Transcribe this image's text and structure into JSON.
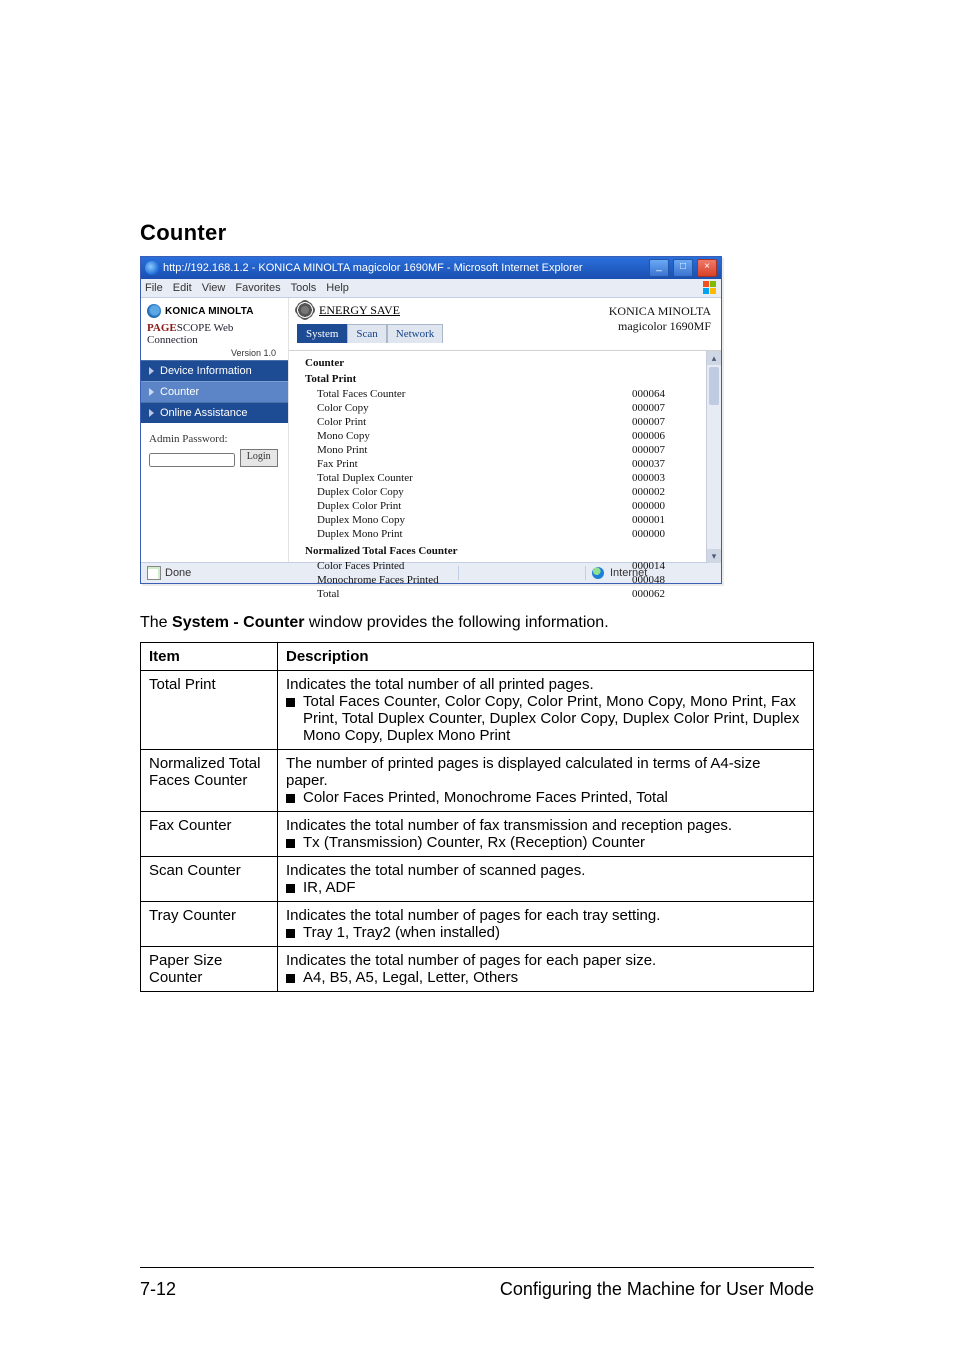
{
  "section_title": "Counter",
  "browser": {
    "title": "http://192.168.1.2 - KONICA MINOLTA magicolor 1690MF - Microsoft Internet Explorer",
    "win_min": "_",
    "win_max": "□",
    "win_close": "×",
    "menu": {
      "file": "File",
      "edit": "Edit",
      "view": "View",
      "favorites": "Favorites",
      "tools": "Tools",
      "help": "Help"
    },
    "brand": "KONICA MINOLTA",
    "pagescope_red": "PAGE",
    "pagescope_rest": "SCOPE",
    "pagescope_tail": " Web Connection",
    "version": "Version 1.0",
    "sidenav": {
      "devinfo": "Device Information",
      "counter": "Counter",
      "online": "Online Assistance"
    },
    "admin_label": "Admin Password:",
    "login_label": "Login",
    "energy_save": "ENERGY SAVE",
    "tabs": {
      "system": "System",
      "scan": "Scan",
      "network": "Network"
    },
    "device_brand": "KONICA MINOLTA",
    "device_model": "magicolor 1690MF",
    "heading": "Counter",
    "sub1": "Total Print",
    "rows1": [
      {
        "lab": "Total Faces Counter",
        "val": "000064"
      },
      {
        "lab": "Color Copy",
        "val": "000007"
      },
      {
        "lab": "Color Print",
        "val": "000007"
      },
      {
        "lab": "Mono Copy",
        "val": "000006"
      },
      {
        "lab": "Mono Print",
        "val": "000007"
      },
      {
        "lab": "Fax Print",
        "val": "000037"
      },
      {
        "lab": "Total Duplex Counter",
        "val": "000003"
      },
      {
        "lab": "Duplex Color Copy",
        "val": "000002"
      },
      {
        "lab": "Duplex Color Print",
        "val": "000000"
      },
      {
        "lab": "Duplex Mono Copy",
        "val": "000001"
      },
      {
        "lab": "Duplex Mono Print",
        "val": "000000"
      }
    ],
    "sub2": "Normalized Total Faces Counter",
    "rows2": [
      {
        "lab": "Color Faces Printed",
        "val": "000014"
      },
      {
        "lab": "Monochrome Faces Printed",
        "val": "000048"
      },
      {
        "lab": "Total",
        "val": "000062"
      }
    ],
    "status_done": "Done",
    "status_internet": "Internet",
    "scroll_up": "▴",
    "scroll_down": "▾"
  },
  "caption_plain_a": "The ",
  "caption_bold": "System - Counter",
  "caption_plain_b": " window provides the following information.",
  "table": {
    "h1": "Item",
    "h2": "Description",
    "rows": [
      {
        "item": "Total Print",
        "desc_top": "Indicates the total number of all printed pages.",
        "bullet": "Total Faces Counter, Color Copy, Color Print, Mono Copy, Mono Print, Fax Print, Total Duplex Counter, Duplex Color Copy, Duplex Color Print, Duplex Mono Copy, Duplex Mono Print"
      },
      {
        "item": "Normalized Total Faces Counter",
        "desc_top": "The number of printed pages is displayed calculated in terms of A4-size paper.",
        "bullet": "Color Faces Printed, Monochrome Faces Printed, Total"
      },
      {
        "item": "Fax Counter",
        "desc_top": "Indicates the total number of fax transmission and reception pages.",
        "bullet": "Tx (Transmission) Counter, Rx (Reception) Counter"
      },
      {
        "item": "Scan Counter",
        "desc_top": "Indicates the total number of scanned pages.",
        "bullet": "IR, ADF"
      },
      {
        "item": "Tray Counter",
        "desc_top": "Indicates the total number of pages for each tray setting.",
        "bullet": "Tray 1, Tray2 (when installed)"
      },
      {
        "item": "Paper Size Counter",
        "desc_top": "Indicates the total number of pages for each paper size.",
        "bullet": "A4, B5, A5, Legal, Letter, Others"
      }
    ]
  },
  "footer": {
    "page": "7-12",
    "text": "Configuring the Machine for User Mode"
  }
}
